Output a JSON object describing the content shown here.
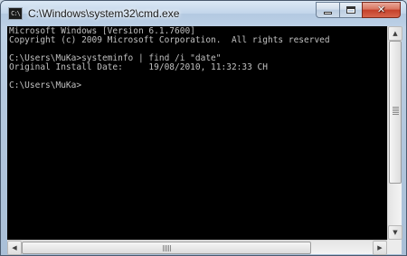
{
  "window": {
    "title": "C:\\Windows\\system32\\cmd.exe",
    "icon": "cmd-icon",
    "icon_text": "C:\\"
  },
  "caption_buttons": {
    "minimize_icon": "minimize-icon",
    "maximize_icon": "maximize-icon",
    "close_icon": "close-icon",
    "close_glyph": "✕"
  },
  "console": {
    "text_color": "#c0c0c0",
    "background": "#000000",
    "lines": [
      "Microsoft Windows [Version 6.1.7600]",
      "Copyright (c) 2009 Microsoft Corporation.  All rights reserved",
      "",
      "C:\\Users\\MuKa>systeminfo | find /i \"date\"",
      "Original Install Date:     19/08/2010, 11:32:33 CH",
      "",
      "C:\\Users\\MuKa>"
    ]
  },
  "scrollbars": {
    "up_arrow": "▲",
    "down_arrow": "▼",
    "left_arrow": "◀",
    "right_arrow": "▶"
  }
}
